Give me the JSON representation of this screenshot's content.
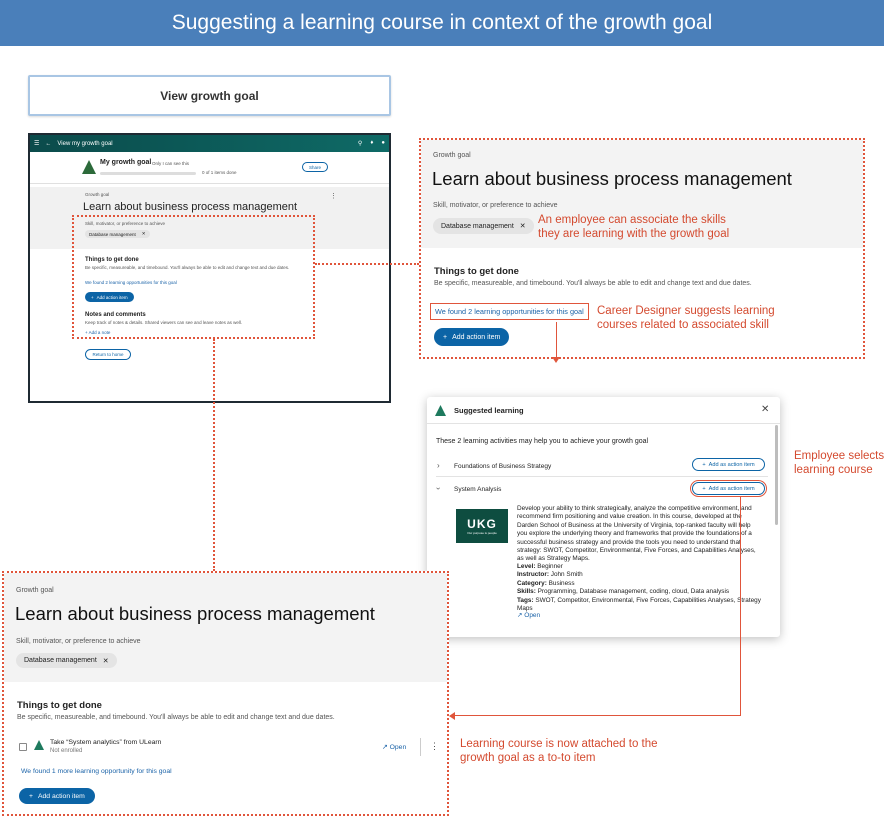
{
  "banner": {
    "title": "Suggesting a learning course in context of the growth goal"
  },
  "view_button": {
    "label": "View growth goal"
  },
  "mini": {
    "topbar_title": "View my growth goal",
    "my_goal_title": "My growth goal",
    "visibility": "Only I can see this",
    "progress": "0 of 1 items done",
    "share": "Share",
    "growth_goal_label": "Growth goal",
    "goal_title": "Learn about business process management",
    "skill_label": "Skill, motivator, or preference to achieve",
    "skill_chip": "Database management",
    "things_title": "Things to get done",
    "things_desc": "Be specific, measureable, and timebound. You'll always be able to edit and change text and due dates.",
    "found_link": "We found 2 learning opportunities for this goal",
    "add_action": "Add action item",
    "notes_title": "Notes and comments",
    "notes_desc": "Keep track of notes & details. Shared viewers can see and leave notes as well.",
    "add_note": "Add a note",
    "return_home": "Return to home"
  },
  "zoom1": {
    "growth_goal_label": "Growth goal",
    "title": "Learn about business process management",
    "skill_label": "Skill, motivator, or preference to achieve",
    "skill_chip": "Database management",
    "things_title": "Things to get done",
    "things_desc": "Be specific, measureable, and timebound. You'll always be able to edit and change text and due dates.",
    "found_link": "We found 2 learning opportunities for this goal",
    "add_action": "Add action item"
  },
  "annotations": {
    "associate": "An employee can associate the skills\nthey are learning with the growth goal",
    "suggests": "Career Designer suggests learning\ncourses related to associated skill",
    "selects": "Employee selects\nlearning course",
    "attached": "Learning course is now attached to the\ngrowth goal as a to-to item"
  },
  "modal": {
    "title": "Suggested learning",
    "intro": "These 2 learning activities may help you to achieve your growth goal",
    "item1": "Foundations of Business Strategy",
    "item2": "System Analysis",
    "add_as_action": "Add as action item",
    "logo_text": "UKG",
    "logo_sub": "Our purpose is people",
    "description": "Develop your ability to think strategically, analyze the competitive environment, and recommend firm positioning and value creation. In this course, developed at the Darden School of Business at the University of Virginia, top-ranked faculty will help you explore the underlying theory and frameworks that provide the foundations of a successful business strategy and provide the tools you need to understand that strategy: SWOT, Competitor, Environmental, Five Forces, and Capabilities Analyses, as well as Strategy Maps.",
    "level_label": "Level:",
    "level_value": "Beginner",
    "instructor_label": "Instructor:",
    "instructor_value": "John Smith",
    "category_label": "Category:",
    "category_value": "Business",
    "skills_label": "Skills:",
    "skills_value": "Programming, Database management, coding, cloud, Data analysis",
    "tags_label": "Tags:",
    "tags_value": "SWOT, Competitor, Environmental, Five Forces, Capabilities Analyses, Strategy Maps",
    "open": "Open"
  },
  "zoom2": {
    "growth_goal_label": "Growth goal",
    "title": "Learn about business process management",
    "skill_label": "Skill, motivator, or preference to achieve",
    "skill_chip": "Database management",
    "things_title": "Things to get done",
    "things_desc": "Be specific, measureable, and timebound. You'll always be able to edit and change text and due dates.",
    "item_title": "Take “System analytics” from ULearn",
    "item_status": "Not enrolled",
    "open": "Open",
    "found_link": "We found 1 more learning opportunity for this goal",
    "add_action": "Add action item"
  }
}
